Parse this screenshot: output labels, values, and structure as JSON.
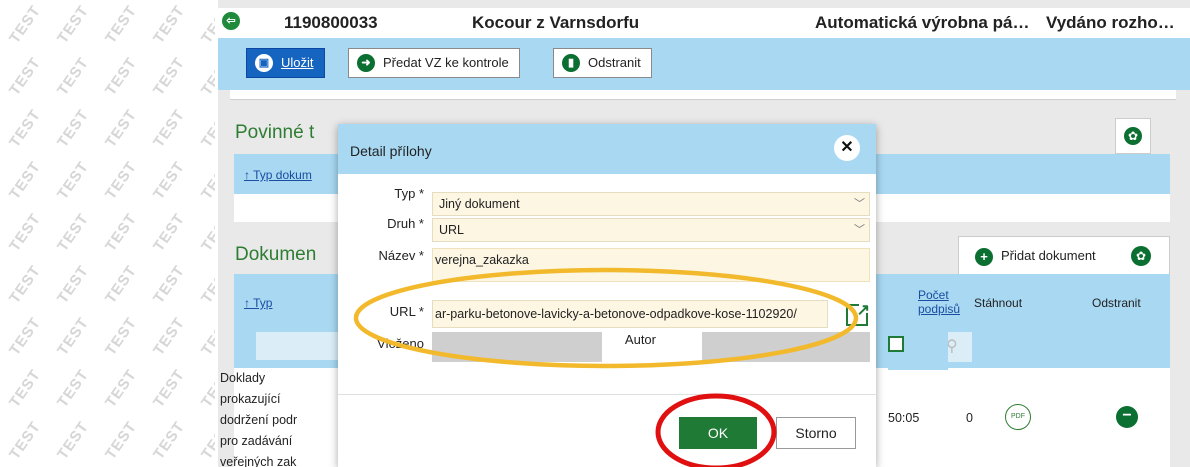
{
  "watermark": "TEST",
  "header": {
    "id": "1190800033",
    "name": "Kocour z Varnsdorfu",
    "type": "Automatická výrobna pá…",
    "status": "Vydáno rozho…"
  },
  "toolbar": {
    "save_label": "Uložit",
    "submit_label": "Předat VZ ke kontrole",
    "delete_label": "Odstranit"
  },
  "sections": {
    "mandatory_title": "Povinné t",
    "mandatory_col": "Typ dokum",
    "documents_title": "Dokumen",
    "add_document_label": "Přidat dokument"
  },
  "documents_table": {
    "col_type": "Typ",
    "col_signatures_line1": "Počet",
    "col_signatures_line2": "podpisů",
    "col_download": "Stáhnout",
    "col_delete": "Odstranit",
    "row": {
      "type_lines": [
        "Doklady",
        "prokazující",
        "dodržení podr",
        "pro zadávání",
        "veřejných zak"
      ],
      "time": "50:05",
      "signatures": "0",
      "download_badge": "PDF"
    }
  },
  "dialog": {
    "title": "Detail přílohy",
    "typ_label": "Typ *",
    "typ_value": "Jiný dokument",
    "druh_label": "Druh *",
    "druh_value": "URL",
    "nazev_label": "Název *",
    "nazev_value": "verejna_zakazka",
    "url_label": "URL *",
    "url_value": "ar-parku-betonove-lavicky-a-betonove-odpadkove-kose-1102920/",
    "vlozeno_label": "Vloženo",
    "autor_label": "Autor",
    "ok_label": "OK",
    "cancel_label": "Storno"
  },
  "colors": {
    "accent_green": "#0a6f31",
    "header_blue": "#a8d8f2",
    "highlight_ellipse": "#f2b92c",
    "highlight_circle": "#e01010"
  }
}
